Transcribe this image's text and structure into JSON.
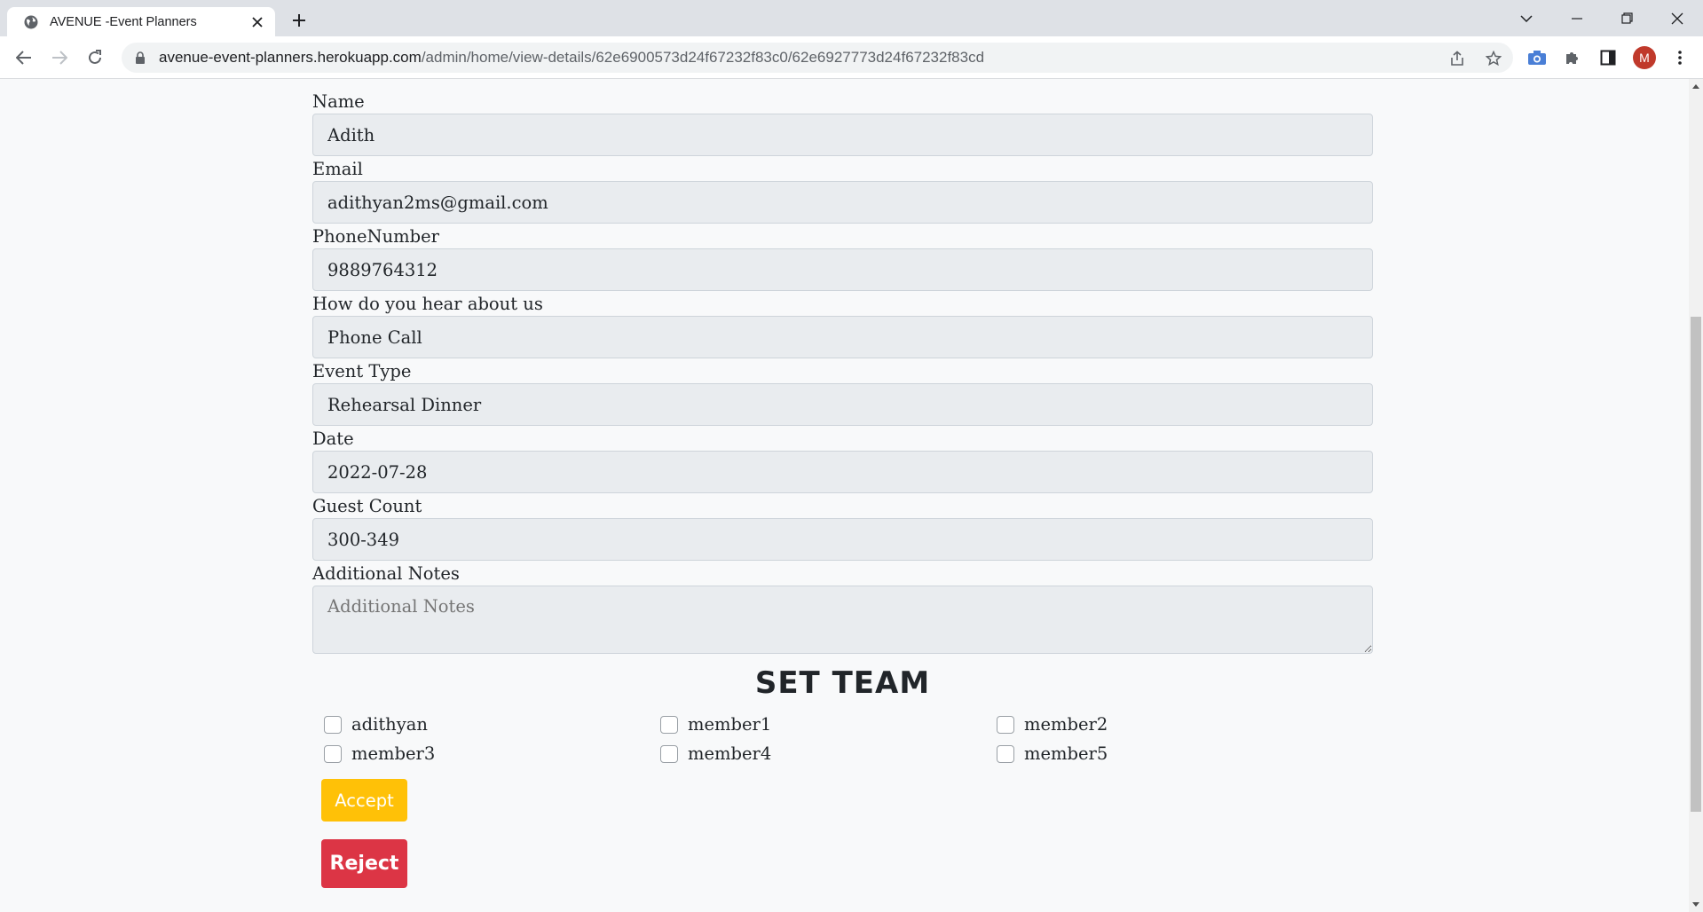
{
  "browser": {
    "tab_title": "AVENUE -Event Planners",
    "url_host": "avenue-event-planners.herokuapp.com",
    "url_path": "/admin/home/view-details/62e6900573d24f67232f83c0/62e6927773d24f67232f83cd",
    "profile_initial": "M"
  },
  "form": {
    "fields": [
      {
        "label": "Name",
        "value": "Adith"
      },
      {
        "label": "Email",
        "value": "adithyan2ms@gmail.com"
      },
      {
        "label": "PhoneNumber",
        "value": "9889764312"
      },
      {
        "label": "How do you hear about us",
        "value": "Phone Call"
      },
      {
        "label": "Event Type",
        "value": "Rehearsal Dinner"
      },
      {
        "label": "Date",
        "value": "2022-07-28"
      },
      {
        "label": "Guest Count",
        "value": "300-349"
      }
    ],
    "notes_label": "Additional Notes",
    "notes_placeholder": "Additional Notes"
  },
  "team": {
    "heading": "SET TEAM",
    "members": [
      "adithyan",
      "member1",
      "member2",
      "member3",
      "member4",
      "member5"
    ]
  },
  "actions": {
    "accept_label": "Accept",
    "reject_label": "Reject"
  },
  "colors": {
    "accept": "#ffc107",
    "reject": "#dc3545",
    "avatar": "#c0392b"
  }
}
